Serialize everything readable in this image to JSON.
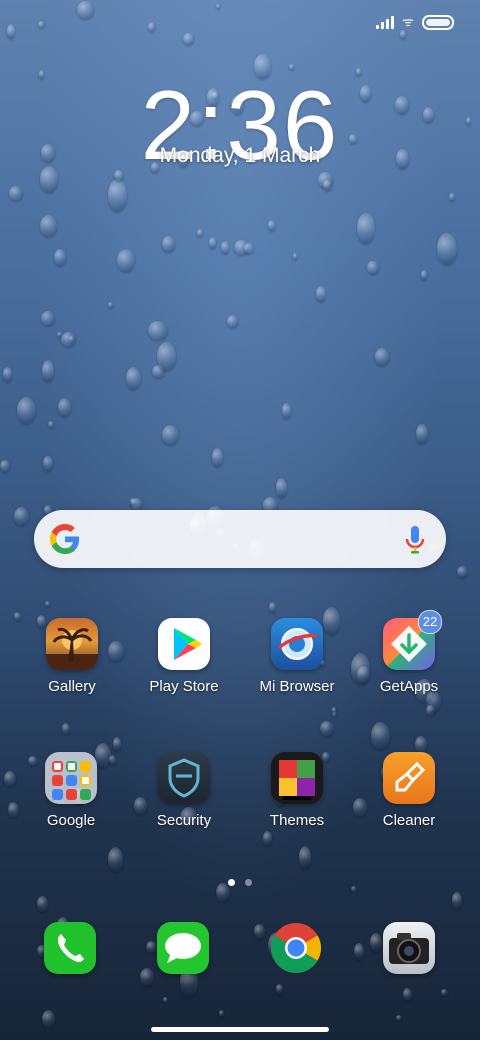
{
  "status_bar": {
    "signal": "signal-icon",
    "wifi": "wifi-icon",
    "battery": "battery-icon"
  },
  "clock": {
    "time": "2:36",
    "date": "Monday, 1 March"
  },
  "search": {
    "logo": "google-g-icon",
    "mic": "mic-icon"
  },
  "row1": [
    {
      "label": "Gallery",
      "icon": "gallery-icon"
    },
    {
      "label": "Play Store",
      "icon": "play-store-icon"
    },
    {
      "label": "Mi Browser",
      "icon": "browser-icon"
    },
    {
      "label": "GetApps",
      "icon": "getapps-icon",
      "badge": "22"
    }
  ],
  "row2": [
    {
      "label": "Google",
      "icon": "google-folder-icon"
    },
    {
      "label": "Security",
      "icon": "security-icon"
    },
    {
      "label": "Themes",
      "icon": "themes-icon"
    },
    {
      "label": "Cleaner",
      "icon": "cleaner-icon"
    }
  ],
  "dock": [
    {
      "icon": "phone-icon"
    },
    {
      "icon": "messages-icon"
    },
    {
      "icon": "chrome-icon"
    },
    {
      "icon": "camera-icon"
    }
  ],
  "pages": {
    "count": 2,
    "active": 1
  }
}
